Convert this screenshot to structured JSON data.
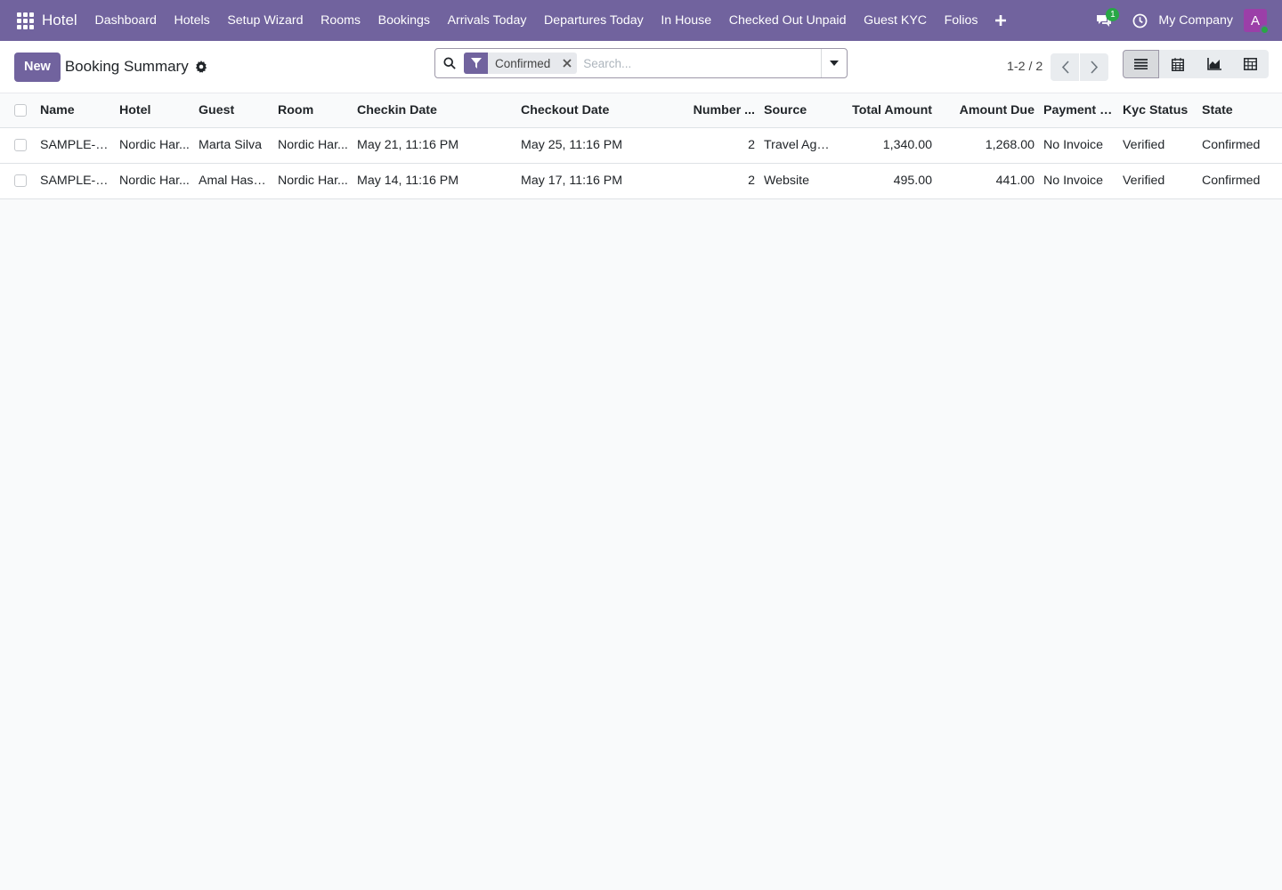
{
  "navbar": {
    "brand": "Hotel",
    "menu": [
      "Dashboard",
      "Hotels",
      "Setup Wizard",
      "Rooms",
      "Bookings",
      "Arrivals Today",
      "Departures Today",
      "In House",
      "Checked Out Unpaid",
      "Guest KYC",
      "Folios"
    ],
    "chat_count": "1",
    "company": "My Company",
    "avatar_letter": "A"
  },
  "control": {
    "new_label": "New",
    "title": "Booking Summary",
    "facet_label": "Confirmed",
    "search_placeholder": "Search...",
    "pager_value": "1-2 / 2"
  },
  "table": {
    "columns": [
      "Name",
      "Hotel",
      "Guest",
      "Room",
      "Checkin Date",
      "Checkout Date",
      "Number ...",
      "Source",
      "Total Amount",
      "Amount Due",
      "Payment S...",
      "Kyc Status",
      "State"
    ],
    "rows": [
      [
        "SAMPLE-H...",
        "Nordic Har...",
        "Marta Silva",
        "Nordic Har...",
        "May 21, 11:16 PM",
        "May 25, 11:16 PM",
        "2",
        "Travel Agent",
        "1,340.00",
        "1,268.00",
        "No Invoice",
        "Verified",
        "Confirmed"
      ],
      [
        "SAMPLE-H...",
        "Nordic Har...",
        "Amal Hassan",
        "Nordic Har...",
        "May 14, 11:16 PM",
        "May 17, 11:16 PM",
        "2",
        "Website",
        "495.00",
        "441.00",
        "No Invoice",
        "Verified",
        "Confirmed"
      ]
    ]
  },
  "colors": {
    "brand": "#71639e",
    "badge": "#28a745",
    "avatar": "#9b3fa8"
  },
  "icons": [
    "apps-grid-icon",
    "chat-icon",
    "clock-icon",
    "gear-icon",
    "search-icon",
    "filter-icon",
    "close-icon",
    "caret-down-icon",
    "chevron-left-icon",
    "chevron-right-icon",
    "list-view-icon",
    "calendar-view-icon",
    "graph-view-icon",
    "pivot-view-icon"
  ]
}
